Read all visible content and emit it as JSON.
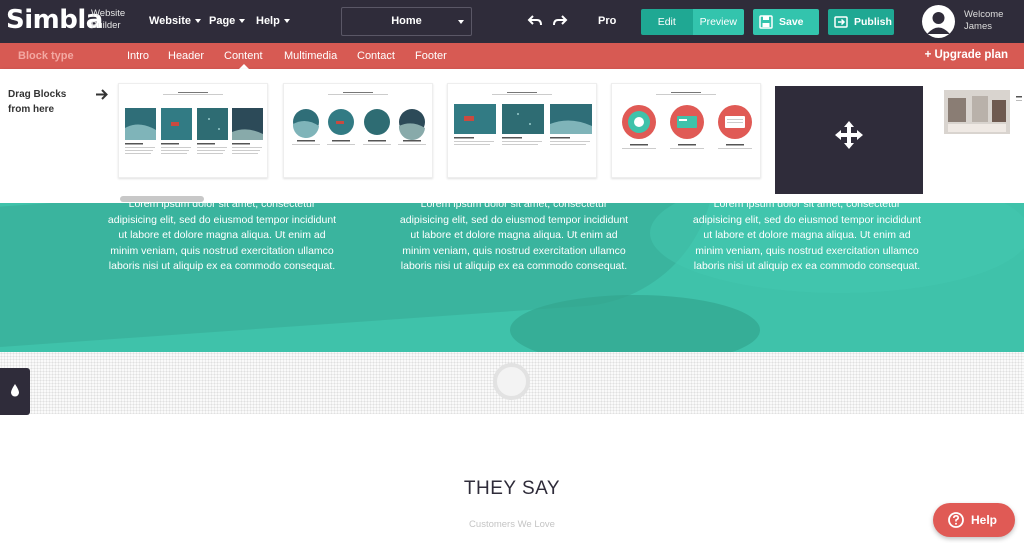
{
  "brand": {
    "logo": "Simbla",
    "subtitle_line1": "Website",
    "subtitle_line2": "Builder"
  },
  "menu": [
    {
      "label": "Website"
    },
    {
      "label": "Page"
    },
    {
      "label": "Help"
    }
  ],
  "page_select": {
    "value": "Home"
  },
  "pro_label": "Pro",
  "mode_toggle": {
    "edit": "Edit",
    "preview": "Preview"
  },
  "actions": {
    "save": "Save",
    "publish": "Publish"
  },
  "user": {
    "welcome": "Welcome",
    "name": "James"
  },
  "block_nav": {
    "label": "Block type",
    "items": [
      "Intro",
      "Header",
      "Content",
      "Multimedia",
      "Contact",
      "Footer"
    ],
    "active": "Content",
    "upgrade": "+ Upgrade plan"
  },
  "blocks_panel": {
    "drag_line1": "Drag Blocks",
    "drag_line2": "from here"
  },
  "hero": {
    "columns": [
      {
        "text": "Lorem ipsum dolor sit amet, consectetur adipisicing elit, sed do eiusmod tempor incididunt ut labore et dolore magna aliqua. Ut enim ad minim veniam, quis nostrud exercitation ullamco laboris nisi ut aliquip ex ea commodo consequat."
      },
      {
        "text": "Lorem ipsum dolor sit amet, consectetur adipisicing elit, sed do eiusmod tempor incididunt ut labore et dolore magna aliqua. Ut enim ad minim veniam, quis nostrud exercitation ullamco laboris nisi ut aliquip ex ea commodo consequat."
      },
      {
        "text": "Lorem ipsum dolor sit amet, consectetur adipisicing elit, sed do eiusmod tempor incididunt ut labore et dolore magna aliqua. Ut enim ad minim veniam, quis nostrud exercitation ullamco laboris nisi ut aliquip ex ea commodo consequat."
      }
    ]
  },
  "testimonials": {
    "title": "THEY SAY",
    "subtitle": "Customers We Love"
  },
  "help": {
    "label": "Help"
  },
  "colors": {
    "dark": "#2f2c3a",
    "teal": "#3fc2aa",
    "red": "#d75a53",
    "button_green": "#1fa893"
  }
}
